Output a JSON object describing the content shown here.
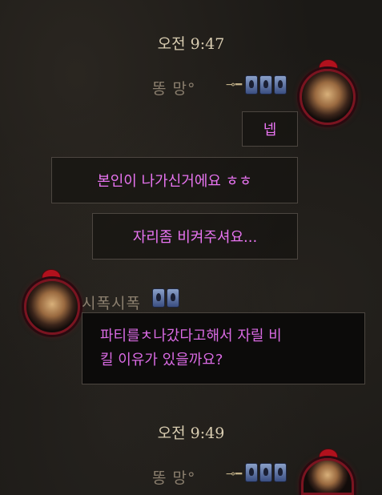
{
  "messages": [
    {
      "time": "오전 9:47"
    },
    {
      "sender": "똥 망°"
    },
    {
      "text": "넵"
    },
    {
      "text": "본인이 나가신거에요 ㅎㅎ"
    },
    {
      "text": "자리좀 비켜주셔요..."
    },
    {
      "sender": "시폭시폭"
    },
    {
      "line1": "파티를ㅊ나갔다고해서 자릴 비",
      "line2": "킬 이유가 있을까요?"
    },
    {
      "time": "오전 9:49"
    },
    {
      "sender": "똥 망°"
    }
  ],
  "icons": {
    "key": "key-icon",
    "badge": "rank-badge-icon",
    "avatar": "character-portrait"
  },
  "colors": {
    "message_text": "#e874f1",
    "time_text": "#d9cdb1",
    "sender_text": "#8b7f6e",
    "avatar_frame": "#7a1420"
  }
}
